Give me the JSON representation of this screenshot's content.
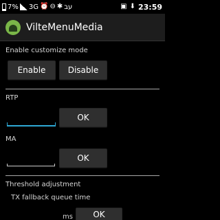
{
  "status_bar": {
    "battery_text": "7%",
    "network_text": "3G",
    "carrier_text": "עב",
    "time": "23:59"
  },
  "action_bar": {
    "title": "VilteMenuMedia"
  },
  "customize": {
    "label": "Enable customize mode",
    "enable_label": "Enable",
    "disable_label": "Disable"
  },
  "rtp": {
    "label": "RTP",
    "ok_label": "OK"
  },
  "ma": {
    "label": "MA",
    "ok_label": "OK"
  },
  "threshold": {
    "label": "Threshold adjustment",
    "sub_label": "TX fallback queue time",
    "unit": "ms",
    "ok_label": "OK"
  }
}
